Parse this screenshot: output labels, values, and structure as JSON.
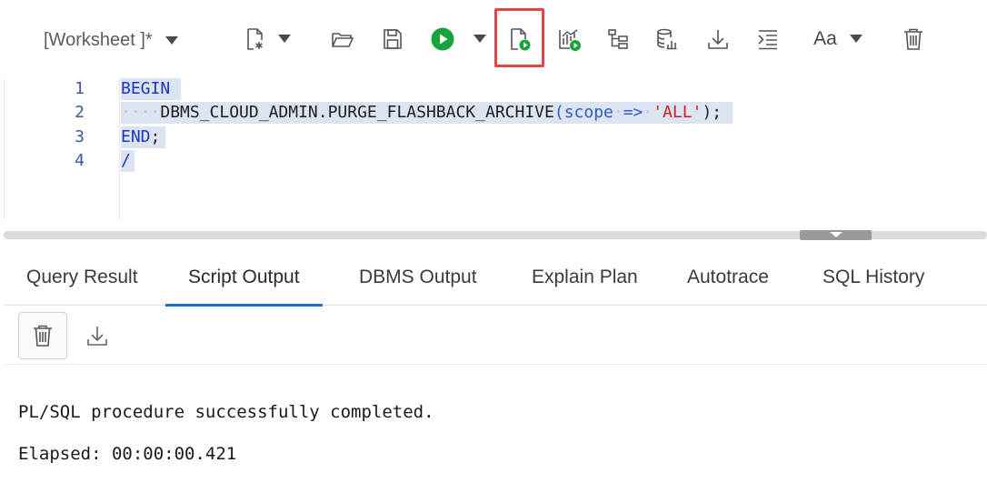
{
  "toolbar": {
    "worksheet_label": "[Worksheet ]*",
    "icons": [
      "new-worksheet-icon",
      "open-folder-icon",
      "save-icon",
      "run-statement-icon",
      "run-script-icon",
      "explain-plan-icon",
      "autotrace-icon",
      "sql-tuning-icon",
      "download-icon",
      "format-icon",
      "font-size-icon",
      "clear-icon"
    ],
    "font_label": "Aa",
    "run_color": "#19a33b",
    "highlight_color": "#e04646"
  },
  "editor": {
    "line_numbers": [
      "1",
      "2",
      "3",
      "4"
    ],
    "lines": {
      "l1": {
        "kw": "BEGIN"
      },
      "l2": {
        "indent": "····",
        "proc": "DBMS_CLOUD_ADMIN.PURGE_FLASHBACK_ARCHIVE",
        "open": "(",
        "param": "scope",
        "sp1": "·",
        "arrow": "=>",
        "sp2": "·",
        "value": "'ALL'",
        "close": ");"
      },
      "l3": {
        "kw": "END",
        "semi": ";"
      },
      "l4": {
        "text": "/"
      }
    }
  },
  "tabs": [
    {
      "label": "Query Result"
    },
    {
      "label": "Script Output",
      "active": true
    },
    {
      "label": "DBMS Output"
    },
    {
      "label": "Explain Plan"
    },
    {
      "label": "Autotrace"
    },
    {
      "label": "SQL History"
    }
  ],
  "output": {
    "line1": "PL/SQL procedure successfully completed.",
    "line2": "Elapsed: 00:00:00.421"
  }
}
